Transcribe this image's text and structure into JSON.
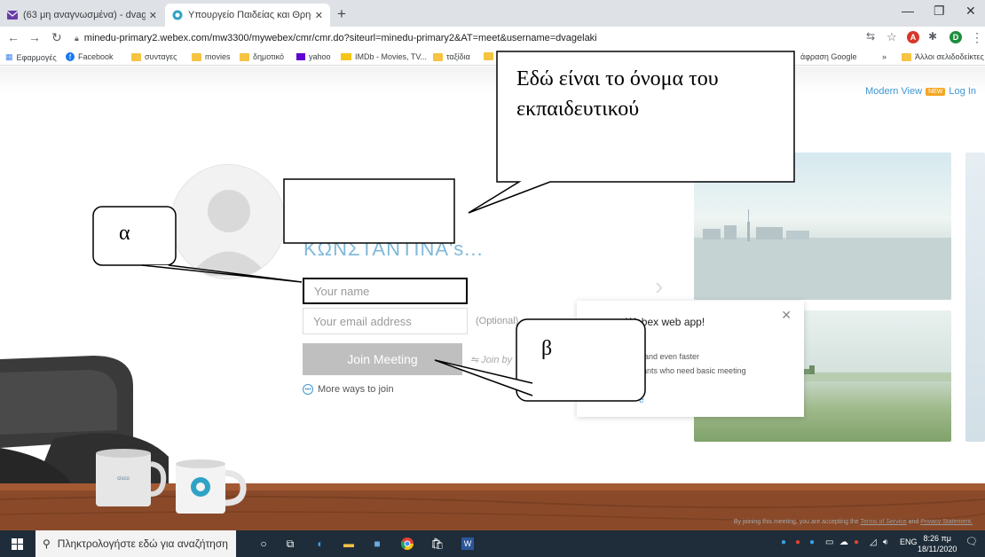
{
  "browser": {
    "tabs": [
      {
        "title": "(63 μη αναγνωσμένα) - dvagelak",
        "active": false
      },
      {
        "title": "Υπουργείο Παιδείας και Θρησκ",
        "active": true
      }
    ],
    "new_tab": "+",
    "close": "✕",
    "url": "minedu-primary2.webex.com/mw3300/mywebex/cmr/cmr.do?siteurl=minedu-primary2&AT=meet&username=dvagelaki",
    "profile_letter": "D",
    "bookmarks": [
      {
        "label": "Εφαρμογές"
      },
      {
        "label": "Facebook"
      },
      {
        "label": "συνταγες"
      },
      {
        "label": "movies"
      },
      {
        "label": "δημοτικό"
      },
      {
        "label": "yahoo"
      },
      {
        "label": "IMDb - Movies, TV..."
      },
      {
        "label": "ταξίδια"
      },
      {
        "label": "άφραση Google"
      },
      {
        "label": "»"
      },
      {
        "label": "Άλλοι σελιδοδείκτες"
      }
    ]
  },
  "page": {
    "modern_view": "Modern View",
    "new_badge": "NEW",
    "login": "Log In",
    "greeting": "ΚΩΝΣΤΑΝΤΙΝΑ's...",
    "name_placeholder": "Your name",
    "email_placeholder": "Your email address",
    "optional": "(Optional)",
    "join_button": "Join Meeting",
    "join_by": "Join by",
    "more_ways": "More ways to join",
    "popup": {
      "title": "Webex web app!",
      "lines": [
        "install",
        "itive, and even faster",
        "rticipants who need basic meeting"
      ],
      "link": "e",
      "close": "✕"
    },
    "terms_prefix": "By joining this meeting, you are accepting the",
    "terms_link": "Terms of Service",
    "terms_and": "and",
    "privacy_link": "Privacy Statement."
  },
  "callouts": {
    "teacher_name": "Εδώ είναι το όνομα του εκπαιδευτικού",
    "alpha": "α",
    "beta": "β"
  },
  "taskbar": {
    "search_placeholder": "Πληκτρολογήστε εδώ για αναζήτηση",
    "language": "ENG",
    "time": "8:26 πμ",
    "date": "18/11/2020",
    "notifications": "10"
  },
  "colors": {
    "webex_blue": "#3f97d3",
    "join_button": "#bfbfbf",
    "taskbar": "#1f2d3a"
  }
}
